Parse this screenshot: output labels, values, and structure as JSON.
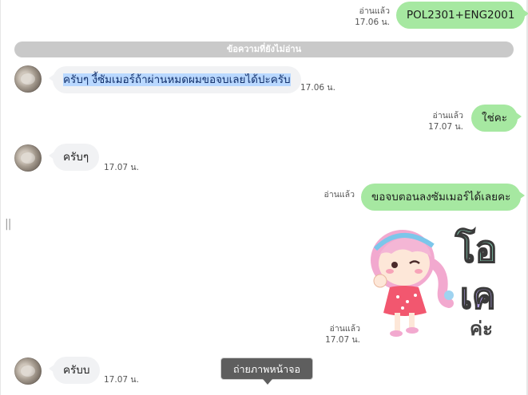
{
  "labels": {
    "read": "อ่านแล้ว",
    "unread_divider": "ข้อความที่ยังไม่อ่าน",
    "tooltip": "ถ่ายภาพหน้าจอ"
  },
  "messages": [
    {
      "id": "m1",
      "direction": "outgoing",
      "text": "POL2301+ENG2001",
      "status": "อ่านแล้ว",
      "time": "17.06 น."
    },
    {
      "id": "m2",
      "direction": "incoming",
      "text": "ครับๆ งี้ซัมเมอร์ถ้าผ่านหมดผมขอจบเลยได้ปะครับ",
      "time": "17.06 น.",
      "selected": true
    },
    {
      "id": "m3",
      "direction": "outgoing",
      "text": "ใช่คะ",
      "status": "อ่านแล้ว",
      "time": "17.07 น."
    },
    {
      "id": "m4",
      "direction": "incoming",
      "text": "ครับๆ",
      "time": "17.07 น."
    },
    {
      "id": "m5",
      "direction": "outgoing",
      "text": "ขอจบตอนลงซัมเมอร์ได้เลยคะ",
      "status": "อ่านแล้ว",
      "time": ""
    },
    {
      "id": "m6",
      "direction": "outgoing",
      "type": "sticker",
      "sticker_text": [
        "โอ",
        "เค",
        "ค่ะ"
      ],
      "status": "อ่านแล้ว",
      "time": "17.07 น."
    },
    {
      "id": "m7",
      "direction": "incoming",
      "text": "ครับบ",
      "time": "17.07 น."
    }
  ],
  "colors": {
    "outgoing_bubble": "#a6e8a1",
    "incoming_bubble": "#f1f2f4",
    "selection": "#b9d8ff",
    "divider": "#c9c9c9"
  }
}
